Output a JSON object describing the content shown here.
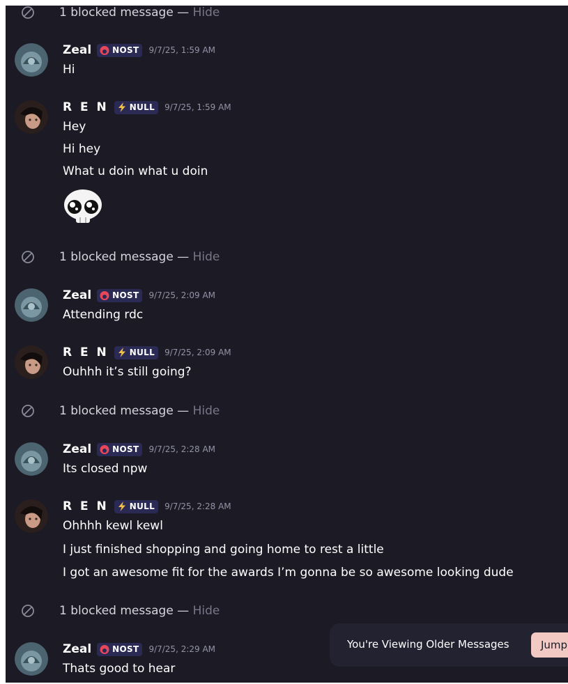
{
  "blocked_notice": {
    "text": "1 blocked message —",
    "hide_label": "Hide",
    "icon": "blocked-icon"
  },
  "users": {
    "zeal": {
      "name": "Zeal",
      "tag": "NOST",
      "tag_icon": "flame-icon",
      "tag_color": "#e8475a"
    },
    "ren": {
      "name": "R E N",
      "tag": "NULL",
      "tag_icon": "lightning-icon",
      "tag_color": "#f3c14a"
    }
  },
  "messages": [
    {
      "author": "Zeal",
      "tag": "NOST",
      "time": "9/7/25, 1:59 AM",
      "lines": [
        "Hi"
      ]
    },
    {
      "author": "R E N",
      "tag": "NULL",
      "time": "9/7/25, 1:59 AM",
      "lines": [
        "Hey",
        "Hi hey",
        "What u doin what u doin"
      ],
      "sticker": "crying-skull-sticker"
    },
    {
      "author": "Zeal",
      "tag": "NOST",
      "time": "9/7/25, 2:09 AM",
      "lines": [
        "Attending rdc"
      ]
    },
    {
      "author": "R E N",
      "tag": "NULL",
      "time": "9/7/25, 2:09 AM",
      "lines": [
        "Ouhhh it’s still going?"
      ]
    },
    {
      "author": "Zeal",
      "tag": "NOST",
      "time": "9/7/25, 2:28 AM",
      "lines": [
        "Its closed npw"
      ]
    },
    {
      "author": "R E N",
      "tag": "NULL",
      "time": "9/7/25, 2:28 AM",
      "lines": [
        "Ohhhh kewl kewl",
        "I just finished shopping and going home to rest a little",
        "I got an awesome fit for the awards I’m gonna be so awesome looking dude"
      ]
    },
    {
      "author": "Zeal",
      "tag": "NOST",
      "time": "9/7/25, 2:29 AM",
      "lines": [
        "Thats good to hear"
      ]
    }
  ],
  "older_messages_bar": {
    "text": "You're Viewing Older Messages",
    "jump_label": "Jump"
  },
  "colors": {
    "background": "#1b1a25",
    "tag_bg": "#2a2a55",
    "jump_button": "#f3c9c4",
    "muted": "#777788"
  }
}
